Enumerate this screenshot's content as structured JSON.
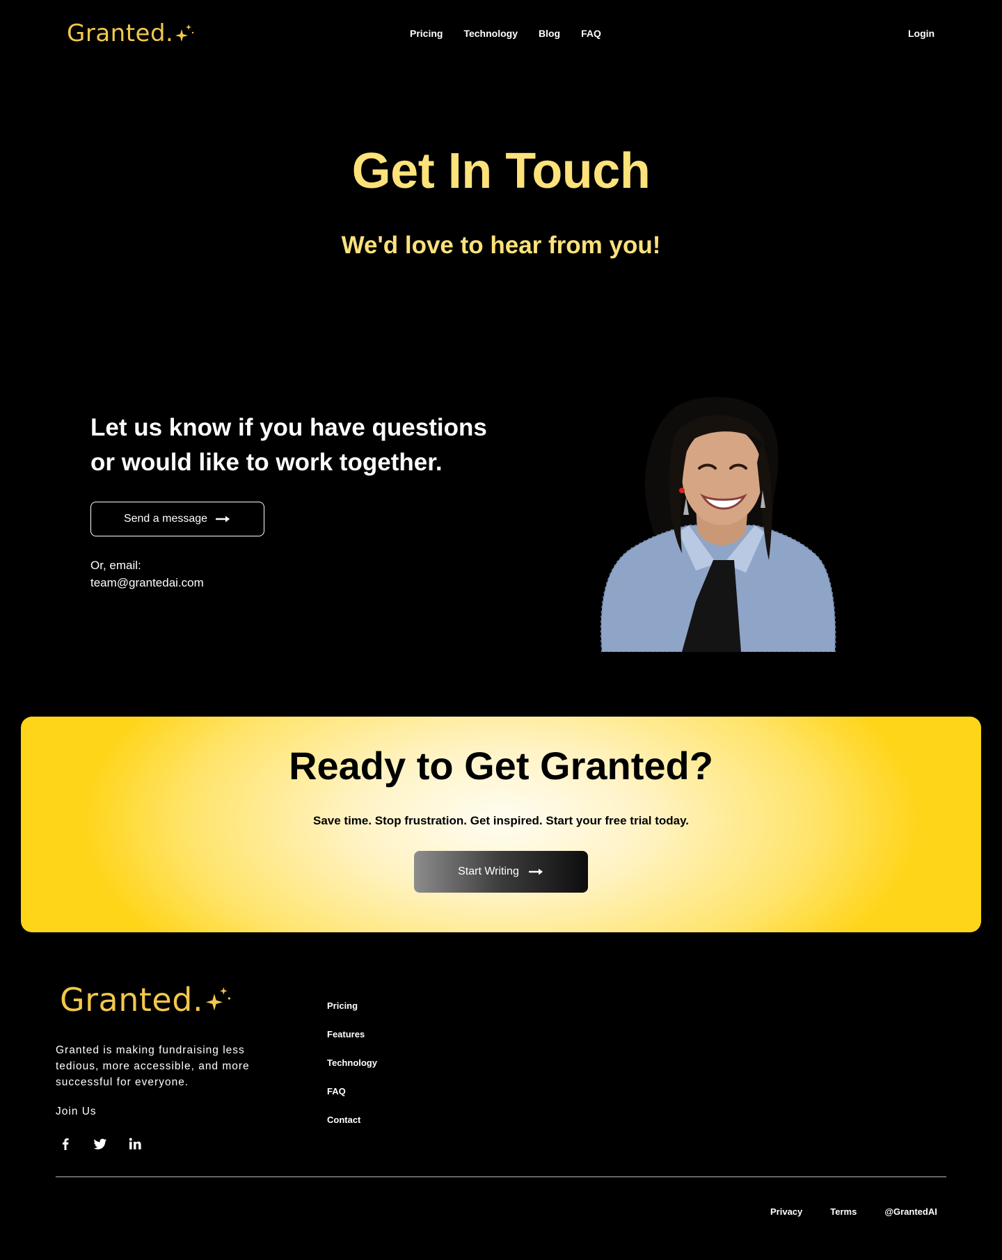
{
  "brand": {
    "name": "Granted",
    "dot": ".",
    "color": "#f2c84b"
  },
  "nav": {
    "items": [
      {
        "label": "Pricing"
      },
      {
        "label": "Technology"
      },
      {
        "label": "Blog"
      },
      {
        "label": "FAQ"
      }
    ],
    "login": "Login"
  },
  "hero": {
    "title": "Get In Touch",
    "subtitle": "We'd love to hear from you!",
    "accent": "#fde27a"
  },
  "contact": {
    "heading": "Let us know if you have questions or would like to work together.",
    "button_label": "Send a message",
    "email_label": "Or, email:",
    "email": "team@grantedai.com"
  },
  "cta": {
    "title": "Ready to Get Granted?",
    "subtitle": "Save time. Stop frustration. Get inspired. Start your free trial today.",
    "button_label": "Start Writing",
    "accent": "#ffd51a"
  },
  "footer": {
    "description": "Granted is making fundraising less tedious, more accessible, and more successful for everyone.",
    "join": "Join Us",
    "social": [
      "facebook-icon",
      "twitter-icon",
      "linkedin-icon"
    ],
    "links": [
      {
        "label": "Pricing"
      },
      {
        "label": "Features"
      },
      {
        "label": "Technology"
      },
      {
        "label": "FAQ"
      },
      {
        "label": "Contact"
      }
    ],
    "bottom_links": [
      {
        "label": "Privacy"
      },
      {
        "label": "Terms"
      },
      {
        "label": "@GrantedAI"
      }
    ]
  }
}
